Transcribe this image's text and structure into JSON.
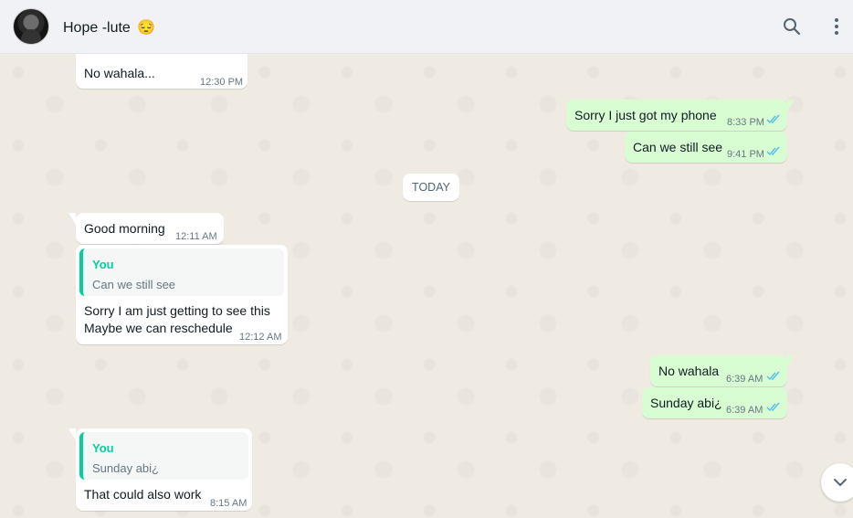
{
  "header": {
    "contact_name": "Hope -lute",
    "contact_emoji": "😔",
    "icons": [
      "search-icon",
      "menu-icon"
    ]
  },
  "day_separator": "TODAY",
  "messages": [
    {
      "direction": "in",
      "text": "No wahala...",
      "time": "12:30 PM"
    },
    {
      "direction": "out",
      "text": "Sorry I just got my phone",
      "time": "8:33 PM",
      "status": "read"
    },
    {
      "direction": "out",
      "text": "Can we still see",
      "time": "9:41 PM",
      "status": "read"
    },
    {
      "direction": "in",
      "text": "Good morning",
      "time": "12:11 AM"
    },
    {
      "direction": "in",
      "reply_to": {
        "author": "You",
        "text": "Can we still see"
      },
      "lines": [
        "Sorry I am just getting to see this",
        "Maybe we can reschedule"
      ],
      "time": "12:12 AM"
    },
    {
      "direction": "out",
      "text": "No wahala",
      "time": "6:39 AM",
      "status": "read"
    },
    {
      "direction": "out",
      "text": "Sunday abi¿",
      "time": "6:39 AM",
      "status": "read"
    },
    {
      "direction": "in",
      "reply_to": {
        "author": "You",
        "text": "Sunday abi¿"
      },
      "text": "That could also work",
      "time": "8:15 AM"
    }
  ],
  "colors": {
    "header_bg": "#f0f2f5",
    "chat_bg": "#efeae2",
    "incoming_bubble": "#ffffff",
    "outgoing_bubble": "#d9fdd3",
    "read_ticks": "#53bdeb",
    "quote_accent": "#06cf9c"
  }
}
